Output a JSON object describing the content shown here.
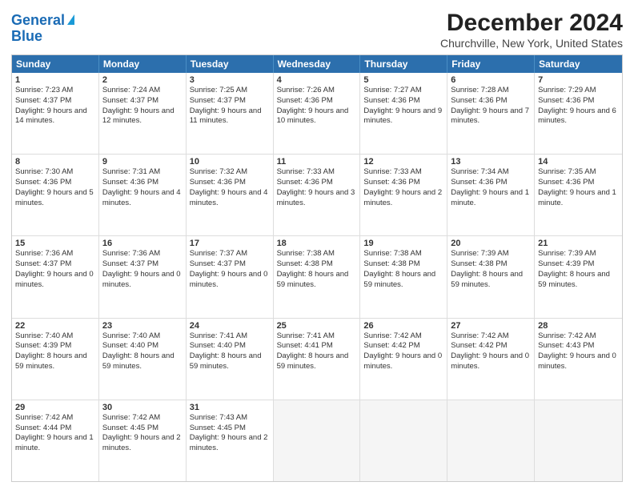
{
  "header": {
    "logo_line1": "General",
    "logo_line2": "Blue",
    "title": "December 2024",
    "subtitle": "Churchville, New York, United States"
  },
  "days": [
    "Sunday",
    "Monday",
    "Tuesday",
    "Wednesday",
    "Thursday",
    "Friday",
    "Saturday"
  ],
  "weeks": [
    [
      {
        "day": "1",
        "sunrise": "Sunrise: 7:23 AM",
        "sunset": "Sunset: 4:37 PM",
        "daylight": "Daylight: 9 hours and 14 minutes."
      },
      {
        "day": "2",
        "sunrise": "Sunrise: 7:24 AM",
        "sunset": "Sunset: 4:37 PM",
        "daylight": "Daylight: 9 hours and 12 minutes."
      },
      {
        "day": "3",
        "sunrise": "Sunrise: 7:25 AM",
        "sunset": "Sunset: 4:37 PM",
        "daylight": "Daylight: 9 hours and 11 minutes."
      },
      {
        "day": "4",
        "sunrise": "Sunrise: 7:26 AM",
        "sunset": "Sunset: 4:36 PM",
        "daylight": "Daylight: 9 hours and 10 minutes."
      },
      {
        "day": "5",
        "sunrise": "Sunrise: 7:27 AM",
        "sunset": "Sunset: 4:36 PM",
        "daylight": "Daylight: 9 hours and 9 minutes."
      },
      {
        "day": "6",
        "sunrise": "Sunrise: 7:28 AM",
        "sunset": "Sunset: 4:36 PM",
        "daylight": "Daylight: 9 hours and 7 minutes."
      },
      {
        "day": "7",
        "sunrise": "Sunrise: 7:29 AM",
        "sunset": "Sunset: 4:36 PM",
        "daylight": "Daylight: 9 hours and 6 minutes."
      }
    ],
    [
      {
        "day": "8",
        "sunrise": "Sunrise: 7:30 AM",
        "sunset": "Sunset: 4:36 PM",
        "daylight": "Daylight: 9 hours and 5 minutes."
      },
      {
        "day": "9",
        "sunrise": "Sunrise: 7:31 AM",
        "sunset": "Sunset: 4:36 PM",
        "daylight": "Daylight: 9 hours and 4 minutes."
      },
      {
        "day": "10",
        "sunrise": "Sunrise: 7:32 AM",
        "sunset": "Sunset: 4:36 PM",
        "daylight": "Daylight: 9 hours and 4 minutes."
      },
      {
        "day": "11",
        "sunrise": "Sunrise: 7:33 AM",
        "sunset": "Sunset: 4:36 PM",
        "daylight": "Daylight: 9 hours and 3 minutes."
      },
      {
        "day": "12",
        "sunrise": "Sunrise: 7:33 AM",
        "sunset": "Sunset: 4:36 PM",
        "daylight": "Daylight: 9 hours and 2 minutes."
      },
      {
        "day": "13",
        "sunrise": "Sunrise: 7:34 AM",
        "sunset": "Sunset: 4:36 PM",
        "daylight": "Daylight: 9 hours and 1 minute."
      },
      {
        "day": "14",
        "sunrise": "Sunrise: 7:35 AM",
        "sunset": "Sunset: 4:36 PM",
        "daylight": "Daylight: 9 hours and 1 minute."
      }
    ],
    [
      {
        "day": "15",
        "sunrise": "Sunrise: 7:36 AM",
        "sunset": "Sunset: 4:37 PM",
        "daylight": "Daylight: 9 hours and 0 minutes."
      },
      {
        "day": "16",
        "sunrise": "Sunrise: 7:36 AM",
        "sunset": "Sunset: 4:37 PM",
        "daylight": "Daylight: 9 hours and 0 minutes."
      },
      {
        "day": "17",
        "sunrise": "Sunrise: 7:37 AM",
        "sunset": "Sunset: 4:37 PM",
        "daylight": "Daylight: 9 hours and 0 minutes."
      },
      {
        "day": "18",
        "sunrise": "Sunrise: 7:38 AM",
        "sunset": "Sunset: 4:38 PM",
        "daylight": "Daylight: 8 hours and 59 minutes."
      },
      {
        "day": "19",
        "sunrise": "Sunrise: 7:38 AM",
        "sunset": "Sunset: 4:38 PM",
        "daylight": "Daylight: 8 hours and 59 minutes."
      },
      {
        "day": "20",
        "sunrise": "Sunrise: 7:39 AM",
        "sunset": "Sunset: 4:38 PM",
        "daylight": "Daylight: 8 hours and 59 minutes."
      },
      {
        "day": "21",
        "sunrise": "Sunrise: 7:39 AM",
        "sunset": "Sunset: 4:39 PM",
        "daylight": "Daylight: 8 hours and 59 minutes."
      }
    ],
    [
      {
        "day": "22",
        "sunrise": "Sunrise: 7:40 AM",
        "sunset": "Sunset: 4:39 PM",
        "daylight": "Daylight: 8 hours and 59 minutes."
      },
      {
        "day": "23",
        "sunrise": "Sunrise: 7:40 AM",
        "sunset": "Sunset: 4:40 PM",
        "daylight": "Daylight: 8 hours and 59 minutes."
      },
      {
        "day": "24",
        "sunrise": "Sunrise: 7:41 AM",
        "sunset": "Sunset: 4:40 PM",
        "daylight": "Daylight: 8 hours and 59 minutes."
      },
      {
        "day": "25",
        "sunrise": "Sunrise: 7:41 AM",
        "sunset": "Sunset: 4:41 PM",
        "daylight": "Daylight: 8 hours and 59 minutes."
      },
      {
        "day": "26",
        "sunrise": "Sunrise: 7:42 AM",
        "sunset": "Sunset: 4:42 PM",
        "daylight": "Daylight: 9 hours and 0 minutes."
      },
      {
        "day": "27",
        "sunrise": "Sunrise: 7:42 AM",
        "sunset": "Sunset: 4:42 PM",
        "daylight": "Daylight: 9 hours and 0 minutes."
      },
      {
        "day": "28",
        "sunrise": "Sunrise: 7:42 AM",
        "sunset": "Sunset: 4:43 PM",
        "daylight": "Daylight: 9 hours and 0 minutes."
      }
    ],
    [
      {
        "day": "29",
        "sunrise": "Sunrise: 7:42 AM",
        "sunset": "Sunset: 4:44 PM",
        "daylight": "Daylight: 9 hours and 1 minute."
      },
      {
        "day": "30",
        "sunrise": "Sunrise: 7:42 AM",
        "sunset": "Sunset: 4:45 PM",
        "daylight": "Daylight: 9 hours and 2 minutes."
      },
      {
        "day": "31",
        "sunrise": "Sunrise: 7:43 AM",
        "sunset": "Sunset: 4:45 PM",
        "daylight": "Daylight: 9 hours and 2 minutes."
      },
      null,
      null,
      null,
      null
    ]
  ]
}
